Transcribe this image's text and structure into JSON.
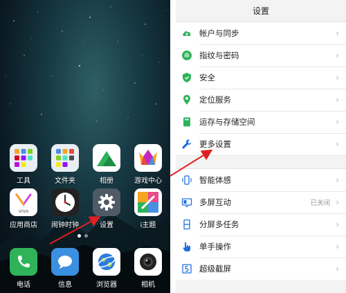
{
  "home": {
    "apps_row1": [
      {
        "label": "工具",
        "icon": "tools-folder-icon"
      },
      {
        "label": "文件夹",
        "icon": "folder-icon"
      },
      {
        "label": "相册",
        "icon": "gallery-icon"
      },
      {
        "label": "游戏中心",
        "icon": "game-center-icon"
      }
    ],
    "apps_row2": [
      {
        "label": "应用商店",
        "icon": "app-store-icon"
      },
      {
        "label": "闹钟时钟",
        "icon": "clock-icon"
      },
      {
        "label": "设置",
        "icon": "settings-gear-icon"
      },
      {
        "label": "i主题",
        "icon": "theme-icon"
      }
    ],
    "dock": [
      {
        "label": "电话",
        "icon": "phone-icon"
      },
      {
        "label": "信息",
        "icon": "messages-icon"
      },
      {
        "label": "浏览器",
        "icon": "browser-icon"
      },
      {
        "label": "相机",
        "icon": "camera-icon"
      }
    ],
    "store_logo_text": "vivo"
  },
  "settings": {
    "title": "设置",
    "group1": [
      {
        "label": "帐户与同步",
        "icon": "cloud-icon",
        "color": "#2fb35a"
      },
      {
        "label": "指纹与密码",
        "icon": "fingerprint-icon",
        "color": "#2fb35a"
      },
      {
        "label": "安全",
        "icon": "shield-icon",
        "color": "#2fb35a"
      },
      {
        "label": "定位服务",
        "icon": "location-pin-icon",
        "color": "#2fb35a"
      },
      {
        "label": "运存与存储空间",
        "icon": "storage-icon",
        "color": "#2fb35a"
      },
      {
        "label": "更多设置",
        "icon": "wrench-icon",
        "color": "#1e6fd9"
      }
    ],
    "group2": [
      {
        "label": "智能体感",
        "icon": "motion-icon",
        "color": "#1e6fd9",
        "status": ""
      },
      {
        "label": "多屏互动",
        "icon": "multi-screen-icon",
        "color": "#1e6fd9",
        "status": "已关闭"
      },
      {
        "label": "分屏多任务",
        "icon": "split-screen-icon",
        "color": "#1e6fd9",
        "status": ""
      },
      {
        "label": "单手操作",
        "icon": "one-hand-icon",
        "color": "#1e6fd9",
        "status": ""
      },
      {
        "label": "超级截屏",
        "icon": "screenshot-icon",
        "color": "#1e6fd9",
        "status": ""
      }
    ],
    "chevron": "›"
  },
  "colors": {
    "green_accent": "#2fb35a",
    "blue_accent": "#1e6fd9",
    "annotation_arrow": "#e02020"
  }
}
